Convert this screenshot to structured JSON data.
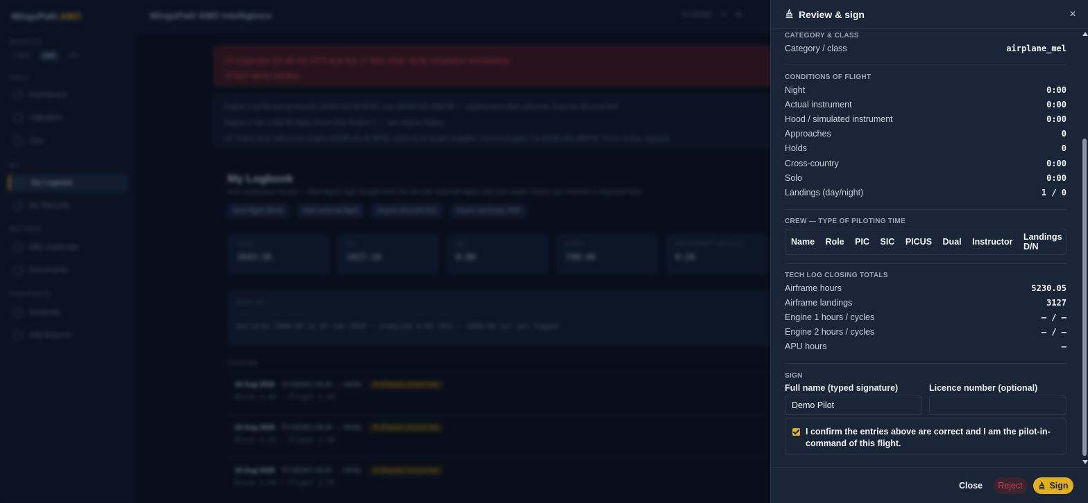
{
  "background": {
    "brand": "WingsPath",
    "brand_suffix": "AMO",
    "mode_section": "MODULES",
    "modes": [
      "CAMO",
      "AMO",
      "ATO"
    ],
    "sidebar_sections": [
      "DAILY",
      "MY",
      "RECORDS",
      "ASSURANCE"
    ],
    "sidebar_items": [
      "Dashboard",
      "Utilisation",
      "Ops",
      "My Logbook",
      "My Records",
      "MEL Deferrals",
      "Documents",
      "Incidents",
      "Add Returns"
    ],
    "app_title": "WingsPath AMO Intelligence",
    "top_right": [
      "5Y-DEMO",
      "≡",
      "⚙"
    ],
    "alerts": [
      "C/I inspection (25-86-04) 2370 was due 17 May 2026. Verify completion immediately.",
      "15 tech items overdue"
    ],
    "warnings": [
      "Engine 2 serial was previously DEMO-E2-9C6P90, now DEMO-E2-388P8F — replacement date unknown, must be documented.",
      "Engine 2 has 3,418.85 fewer hours than Engine 1 — see engine history.",
      "UK Status form references engine DEMO-E2-9C6P90, which is no longer installed. Current Engine 2 is DEMO-E2-388P8F. Form review required."
    ],
    "logbook_title": "My Logbook",
    "logbook_subtitle": "One continuous record — fleet flights sign straight from the aircraft; external flights and your paper history are entered or imported here.",
    "logbook_actions": [
      "New flight (fleet)",
      "Add external flight",
      "Import (Excel/CSV)",
      "Hours summary PDF"
    ],
    "stats": [
      {
        "label": "TOTAL",
        "value": "1643:36"
      },
      {
        "label": "PIC",
        "value": "1827:16"
      },
      {
        "label": "SIC",
        "value": "0:00"
      },
      {
        "label": "NIGHT",
        "value": "790:46"
      },
      {
        "label": "INSTRUMENT (ACTUAL)",
        "value": "0:26"
      }
    ],
    "backlog_label": "BACKLOG",
    "backlog_text": "Declared 1800:00 to 01 Jan 2026 · itemised 0:00 (0%) · 1800:00 not yet logged",
    "pending_label": "PENDING",
    "flights": [
      {
        "date": "18 Aug 2026",
        "reg": "5Y-DEMO HKJK → HKML",
        "badge": "⚑ PENDING SIGNATURE",
        "times": "Block 1:45 · Flight 1:30"
      },
      {
        "date": "18 Aug 2026",
        "reg": "5Y-DEMO HKJK → HKML",
        "badge": "⚑ PENDING SIGNATURE",
        "times": "Block 1:45 · Flight 1:30"
      },
      {
        "date": "18 Aug 2026",
        "reg": "5Y-DEMO HKJK → HKML",
        "badge": "⚑ PENDING SIGNATURE",
        "times": "Block 1:45 · Flight 1:30"
      }
    ]
  },
  "panel": {
    "title": "Review & sign",
    "pen_icon": "pen-icon",
    "close_icon": "×",
    "category": {
      "section": "CATEGORY & CLASS",
      "label": "Category / class",
      "value": "airplane_mel"
    },
    "conditions": {
      "section": "CONDITIONS OF FLIGHT",
      "rows": [
        {
          "k": "Night",
          "v": "0:00"
        },
        {
          "k": "Actual instrument",
          "v": "0:00"
        },
        {
          "k": "Hood / simulated instrument",
          "v": "0:00"
        },
        {
          "k": "Approaches",
          "v": "0"
        },
        {
          "k": "Holds",
          "v": "0"
        },
        {
          "k": "Cross-country",
          "v": "0:00"
        },
        {
          "k": "Solo",
          "v": "0:00"
        },
        {
          "k": "Landings (day/night)",
          "v": "1 / 0"
        }
      ]
    },
    "crew": {
      "section": "CREW — TYPE OF PILOTING TIME",
      "columns": [
        "Name",
        "Role",
        "PIC",
        "SIC",
        "PICUS",
        "Dual",
        "Instructor",
        "Landings D/N"
      ]
    },
    "techlog": {
      "section": "TECH LOG CLOSING TOTALS",
      "rows": [
        {
          "k": "Airframe hours",
          "v": "5230.05"
        },
        {
          "k": "Airframe landings",
          "v": "3127"
        },
        {
          "k": "Engine 1 hours / cycles",
          "v": "– / –"
        },
        {
          "k": "Engine 2 hours / cycles",
          "v": "– / –"
        },
        {
          "k": "APU hours",
          "v": "–"
        }
      ]
    },
    "sign": {
      "section": "SIGN",
      "full_name_label": "Full name (typed signature)",
      "full_name_value": "Demo Pilot",
      "licence_label": "Licence number (optional)",
      "licence_value": "",
      "confirm_text": "I confirm the entries above are correct and I am the pilot-in-command of this flight.",
      "confirm_checked": true
    },
    "footer": {
      "close_label": "Close",
      "reject_label": "Reject",
      "sign_label": "Sign"
    },
    "colors": {
      "accent": "#e0b020",
      "danger": "#c2454f",
      "panel_bg": "#1a2638"
    }
  }
}
